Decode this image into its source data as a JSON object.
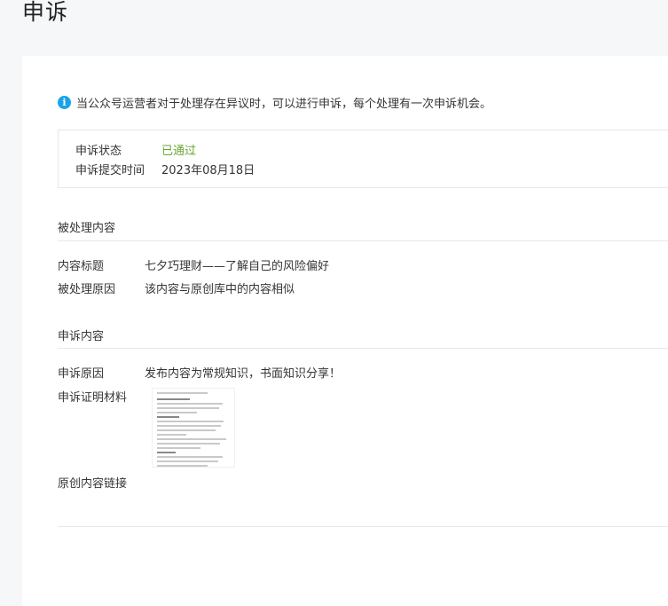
{
  "page": {
    "title": "申诉"
  },
  "notice": {
    "icon": "info-icon",
    "text": "当公众号运营者对于处理存在异议时，可以进行申诉，每个处理有一次申诉机会。"
  },
  "status": {
    "state_label": "申诉状态",
    "state_value": "已通过",
    "state_color": "#68a630",
    "time_label": "申诉提交时间",
    "time_value": "2023年08月18日"
  },
  "processed": {
    "section_title": "被处理内容",
    "content_title_label": "内容标题",
    "content_title_value": "七夕巧理财——了解自己的风险偏好",
    "reason_label": "被处理原因",
    "reason_value": "该内容与原创库中的内容相似"
  },
  "appeal": {
    "section_title": "申诉内容",
    "reason_label": "申诉原因",
    "reason_value": "发布内容为常规知识，书面知识分享！",
    "proof_label": "申诉证明材料",
    "link_label": "原创内容链接"
  },
  "colors": {
    "accent": "#1aa3e8",
    "success": "#68a630"
  }
}
